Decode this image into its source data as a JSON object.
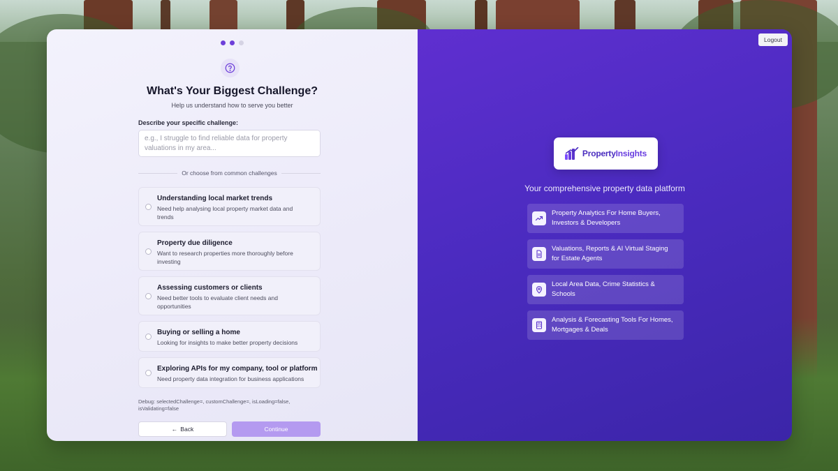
{
  "progress": {
    "total_steps": 3,
    "completed_steps": 2
  },
  "challenge": {
    "title": "What's Your Biggest Challenge?",
    "subtitle": "Help us understand how to serve you better",
    "field_label": "Describe your specific challenge:",
    "field_value": "",
    "field_placeholder": "e.g., I struggle to find reliable data for property valuations in my area...",
    "divider_text": "Or choose from common challenges",
    "options": [
      {
        "title": "Understanding local market trends",
        "description": "Need help analysing local property market data and trends",
        "selected": false
      },
      {
        "title": "Property due diligence",
        "description": "Want to research properties more thoroughly before investing",
        "selected": false
      },
      {
        "title": "Assessing customers or clients",
        "description": "Need better tools to evaluate client needs and opportunities",
        "selected": false
      },
      {
        "title": "Buying or selling a home",
        "description": "Looking for insights to make better property decisions",
        "selected": false
      },
      {
        "title": "Exploring APIs for my company, tool or platform",
        "description": "Need property data integration for business applications",
        "selected": false
      }
    ],
    "debug_text": "Debug: selectedChallenge=, customChallenge=, isLoading=false, isValidating=false",
    "back_label": "Back",
    "continue_label": "Continue"
  },
  "brand": {
    "logout_label": "Logout",
    "logo_part1": "Property",
    "logo_part2": "Insights",
    "tagline": "Your comprehensive property data platform",
    "features": [
      {
        "icon": "trending-up-icon",
        "text": "Property Analytics For Home Buyers, Investors & Developers"
      },
      {
        "icon": "document-icon",
        "text": "Valuations, Reports & AI Virtual Staging for Estate Agents"
      },
      {
        "icon": "map-pin-icon",
        "text": "Local Area Data, Crime Statistics & Schools"
      },
      {
        "icon": "calculator-icon",
        "text": "Analysis & Forecasting Tools For Homes, Mortgages & Deals"
      }
    ]
  },
  "colors": {
    "accent": "#6d3fd9",
    "panel_purple": "#4b2bc0",
    "continue_disabled": "#b49af0"
  }
}
